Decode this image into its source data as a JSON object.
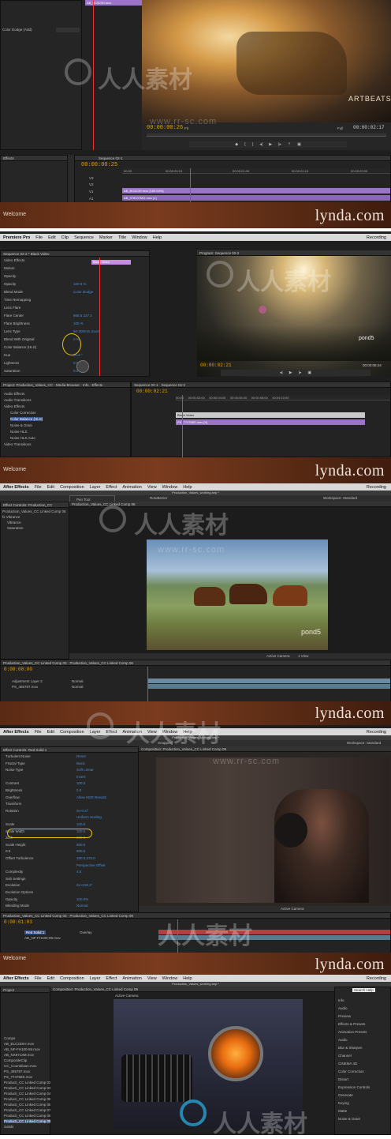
{
  "watermark": {
    "text": "人人素材",
    "url": "www.rr-sc.com"
  },
  "banner": {
    "welcome": "Welcome",
    "brand": "lynda.com"
  },
  "frame1": {
    "clip_top": "AB_BC523H.mov",
    "blend_label": "Color Dodge (Add)",
    "effects_tab": "Effects",
    "sequence_tab": "Sequence 02-1",
    "timecode": "00:00:00:25",
    "program_timecode": "00:00:00:26",
    "program_end": "00:00:02:17",
    "fit": "Fit",
    "quality": "Full",
    "ruler": [
      "00:00",
      "00:00:00:15",
      "00:00:01:00",
      "00:00:01:15",
      "00:00:02:00"
    ],
    "track_labels": [
      "V3",
      "V2",
      "V1",
      "A1",
      "A2"
    ],
    "clip_v2": "AB_BC523H.mov [189.54%]",
    "clip_v1": "AB_978107MG.mov [1]",
    "artbeats": "ARTBEATS"
  },
  "frame2": {
    "menu": [
      "Premiere Pro",
      "File",
      "Edit",
      "Clip",
      "Sequence",
      "Marker",
      "Title",
      "Window",
      "Help"
    ],
    "menu_right": "Recording",
    "tabs": "Sequence 02-2 * Black Video",
    "effect_rows": [
      {
        "name": "Video Effects",
        "value": ""
      },
      {
        "name": "Motion",
        "value": ""
      },
      {
        "name": "Opacity",
        "value": ""
      },
      {
        "name": "Opacity",
        "value": "100.0 %"
      },
      {
        "name": "Blend Mode",
        "value": "Color Dodge"
      },
      {
        "name": "Time Remapping",
        "value": ""
      },
      {
        "name": "Lens Flare",
        "value": ""
      },
      {
        "name": "Flare Center",
        "value": "868.5  227.4"
      },
      {
        "name": "Flare Brightness",
        "value": "100 %"
      },
      {
        "name": "Lens Type",
        "value": "50-300mm Zoom"
      },
      {
        "name": "Blend With Original",
        "value": "0 %"
      },
      {
        "name": "Color Balance (HLS)",
        "value": ""
      },
      {
        "name": "Hue",
        "value": "61.8 °"
      },
      {
        "name": "Lightness",
        "value": "0.0"
      },
      {
        "name": "Saturation",
        "value": "0.0"
      }
    ],
    "clip_label": "Black Video",
    "program_tab": "Program: Sequence 02-2",
    "program_timecode": "00:00:02:21",
    "program_end": "00:00:06:24",
    "seq_timecode": "00:00:02:21",
    "project_rows": [
      "Audio Effects",
      "Audio Transitions",
      "Video Effects",
      "Color Correction",
      "Color Balance (HLS)",
      "Noise & Grain",
      "Noise HLS",
      "Noise HLS Auto",
      "Video Transitions"
    ],
    "clip_black": "Black Video",
    "clip_ps": "PS_774768S.mov [V]",
    "pond5": "pond5"
  },
  "frame3": {
    "menu": [
      "After Effects",
      "File",
      "Edit",
      "Composition",
      "Layer",
      "Effect",
      "Animation",
      "View",
      "Window",
      "Help"
    ],
    "menu_right": "Recording",
    "title": "Production_Values_working.aep *",
    "tool_menu": [
      "Pen Tool",
      "Add Vertex Tool",
      "Delete Vertex Tool",
      "Convert Vertex Tool",
      "Mask Feather Tool"
    ],
    "effect_tab": "Effect Controls: Production_CC",
    "effect_rows": [
      "Production_Values_CC Linked Comp 06",
      "fx Vibrance",
      "Vibrance",
      "Saturation"
    ],
    "comp_tab": "Production_Values_CC Linked Comp 06",
    "rotobezier": "RotoBezier",
    "workspace": "Workspace: Standard",
    "timecode": "0:00:00:00",
    "layers": [
      "Adjustment Layer 2",
      "PS_485787.mov"
    ],
    "mode": "Normal",
    "view": "Active Camera",
    "views": "1 View",
    "pond5": "pond5"
  },
  "frame4": {
    "menu": [
      "After Effects",
      "File",
      "Edit",
      "Composition",
      "Layer",
      "Effect",
      "Animation",
      "View",
      "Window",
      "Help"
    ],
    "menu_right": "Recording",
    "title": "Production_Values_working.aep *",
    "effect_tab": "Effect Controls: Red Solid 1",
    "comp_tab": "Composition: Production_Values_CC Linked Comp 09",
    "rows": [
      {
        "name": "Turbulent Noise",
        "value": "Reset"
      },
      {
        "name": "Fractal Type",
        "value": "Basic"
      },
      {
        "name": "Noise Type",
        "value": "Soft Linear"
      },
      {
        "name": "",
        "value": "Invert"
      },
      {
        "name": "Contrast",
        "value": "100.0"
      },
      {
        "name": "Brightness",
        "value": "0.0"
      },
      {
        "name": "Overflow",
        "value": "Allow HDR Results"
      },
      {
        "name": "Transform",
        "value": ""
      },
      {
        "name": "Rotation",
        "value": "0x+0.0°"
      },
      {
        "name": "",
        "value": "Uniform Scaling"
      },
      {
        "name": "Scale",
        "value": "100.0"
      },
      {
        "name": "Scale Width",
        "value": "100.0"
      },
      {
        "name": "20.0",
        "value": "600.0"
      },
      {
        "name": "Scale Height",
        "value": "800.0"
      },
      {
        "name": "0.0",
        "value": "600.0"
      },
      {
        "name": "Offset Turbulence",
        "value": "480.0,270.0"
      },
      {
        "name": "",
        "value": "Perspective Offset"
      },
      {
        "name": "Complexity",
        "value": "4.5"
      },
      {
        "name": "Sub Settings",
        "value": ""
      },
      {
        "name": "Evolution",
        "value": "0x+218.3°"
      },
      {
        "name": "Evolution Options",
        "value": ""
      },
      {
        "name": "Opacity",
        "value": "100.0%"
      },
      {
        "name": "Blending Mode",
        "value": "Normal"
      }
    ],
    "timecode": "0:00:01:03",
    "layers": [
      "Red Solid 1",
      "AB_NF-FH100-59.mov"
    ],
    "mode": "Overlay",
    "view": "Active Camera",
    "snapping": "Snapping",
    "workspace": "Workspace: Standard"
  },
  "frame5": {
    "menu": [
      "After Effects",
      "File",
      "Edit",
      "Composition",
      "Layer",
      "Effect",
      "Animation",
      "View",
      "Window",
      "Help"
    ],
    "menu_right": "Recording",
    "title": "Production_Values_working.aep *",
    "project_tab": "Project",
    "project_items": [
      "Comps",
      "AB_ELC23SH.mov",
      "AB_NF-FH100-59.mov",
      "AB_NX8713M.mov",
      "CompositeClip",
      "CC_Countdown.mov",
      "PS_485787.mov",
      "PS_774768S.mov",
      "Producti_CC Linked Comp 02",
      "Producti_CC Linked Comp 03",
      "Producti_CC Linked Comp 04",
      "Producti_CC Linked Comp 05",
      "Producti_CC Linked Comp 06",
      "Producti_CC Linked Comp 07",
      "Producti_CC Linked Comp 08",
      "Producti_CC Linked Comp 09",
      "Solids"
    ],
    "comp_tab": "Composition: Production_Values_CC Linked Comp 09",
    "view": "Active Camera",
    "right_panel": [
      "Info",
      "Audio",
      "Preview",
      "Effects & Presets",
      "Animation Presets",
      "Audio",
      "Blur & Sharpen",
      "Channel",
      "CINEMA 4D",
      "Color Correction",
      "Distort",
      "Expression Controls",
      "Generate",
      "Keying",
      "Matte",
      "Noise & Grain"
    ],
    "search": "Search Help"
  }
}
